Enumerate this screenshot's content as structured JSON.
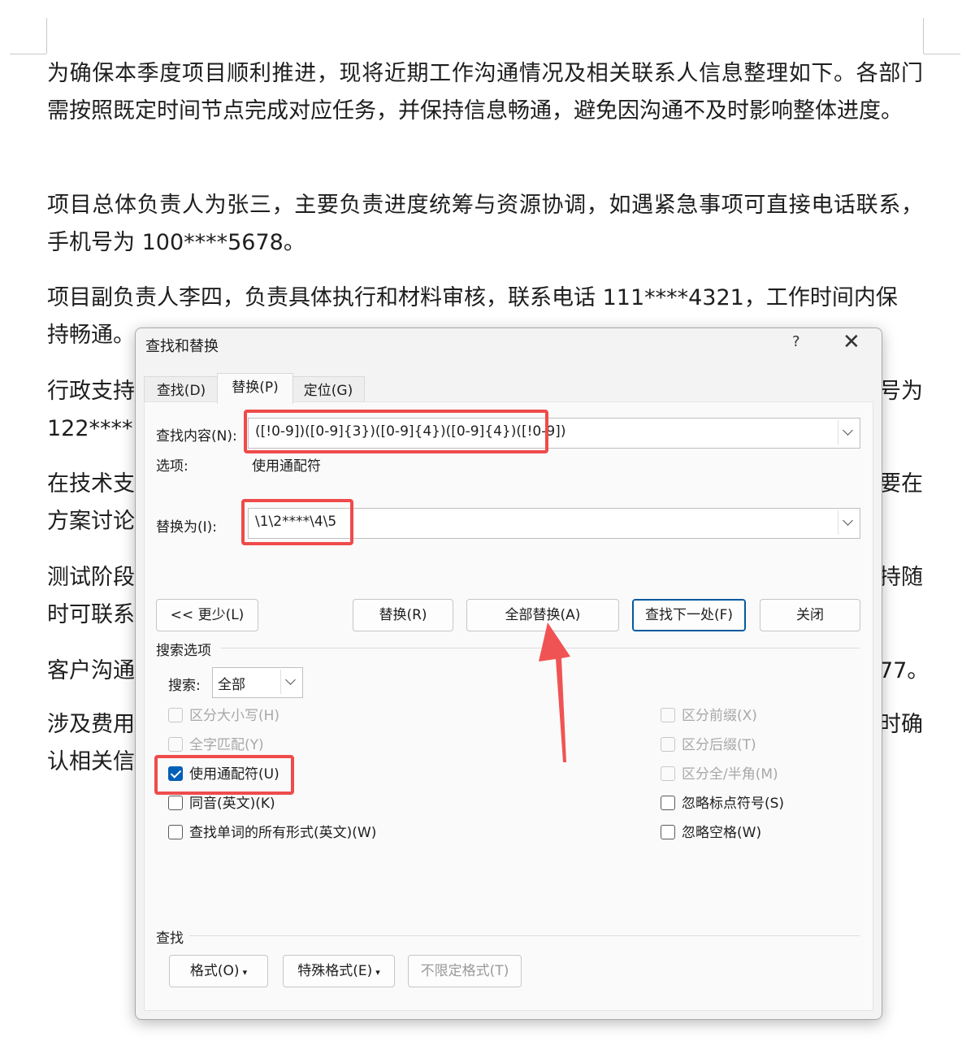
{
  "document": {
    "paragraphs": [
      "为确保本季度项目顺利推进，现将近期工作沟通情况及相关联系人信息整理如下。各部门需按照既定时间节点完成对应任务，并保持信息畅通，避免因沟通不及时影响整体进度。",
      "项目总体负责人为张三，主要负责进度统筹与资源协调，如遇紧急事项可直接电话联系，手机号为 100****5678。",
      "项目副负责人李四，负责具体执行和材料审核，联系电话 111****4321，工作时间内保持畅通。",
      "行政支持…号为 122****1…",
      "在技术支…要在方案讨论…",
      "测试阶段…持随时可联系…",
      "客户沟通…77。",
      "涉及费用…时确认相关信…"
    ],
    "visible_fragments": {
      "p3_end": "持畅通。",
      "p4_start": "行政支持",
      "p4_right": "号为",
      "p4_line2": "122****1",
      "p5_start": "在技术支",
      "p5_right": "要在",
      "p5_line2": "方案讨论",
      "p6_start": "测试阶段",
      "p6_right": "持随",
      "p6_line2": "时可联系",
      "p7_start": "客户沟通",
      "p7_right": "77。",
      "p8_start": "涉及费用",
      "p8_right": "时确",
      "p8_line2": "认相关信"
    }
  },
  "dialog": {
    "title": "查找和替换",
    "help": "?",
    "close": "✕",
    "tabs": [
      "查找(D)",
      "替换(P)",
      "定位(G)"
    ],
    "active_tab": 1,
    "find_label": "查找内容(N):",
    "find_value": "([!0-9])([0-9]{3})([0-9]{4})([0-9]{4})([!0-9])",
    "options_label": "选项:",
    "options_value": "使用通配符",
    "replace_label": "替换为(I):",
    "replace_value": "\\1\\2****\\4\\5",
    "buttons": {
      "less": "<< 更少(L)",
      "replace": "替换(R)",
      "replace_all": "全部替换(A)",
      "find_next": "查找下一处(F)",
      "close": "关闭"
    },
    "search_options_title": "搜索选项",
    "search_label": "搜索:",
    "search_value": "全部",
    "checkboxes_left": [
      {
        "label": "区分大小写(H)",
        "checked": false,
        "disabled": true
      },
      {
        "label": "全字匹配(Y)",
        "checked": false,
        "disabled": true
      },
      {
        "label": "使用通配符(U)",
        "checked": true,
        "disabled": false
      },
      {
        "label": "同音(英文)(K)",
        "checked": false,
        "disabled": false
      },
      {
        "label": "查找单词的所有形式(英文)(W)",
        "checked": false,
        "disabled": false
      }
    ],
    "checkboxes_right": [
      {
        "label": "区分前缀(X)",
        "checked": false,
        "disabled": true
      },
      {
        "label": "区分后缀(T)",
        "checked": false,
        "disabled": true
      },
      {
        "label": "区分全/半角(M)",
        "checked": false,
        "disabled": true
      },
      {
        "label": "忽略标点符号(S)",
        "checked": false,
        "disabled": false
      },
      {
        "label": "忽略空格(W)",
        "checked": false,
        "disabled": false
      }
    ],
    "find_section_title": "查找",
    "bottom_buttons": {
      "format": "格式(O)",
      "special": "特殊格式(E)",
      "no_format": "不限定格式(T)"
    }
  },
  "colors": {
    "highlight": "#ef4b4b",
    "accent": "#005fb8"
  }
}
